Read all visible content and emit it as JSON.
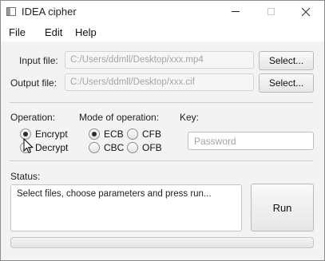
{
  "window": {
    "title": "IDEA cipher",
    "icon": "app-window-icon"
  },
  "menu": {
    "items": [
      "File",
      "Edit",
      "Help"
    ]
  },
  "files": {
    "input_label": "Input file:",
    "input_value": "C:/Users/ddmll/Desktop/xxx.mp4",
    "output_label": "Output file:",
    "output_value": "C:/Users/ddmll/Desktop/xxx.cif",
    "select_label": "Select..."
  },
  "operation": {
    "label": "Operation:",
    "options": [
      "Encrypt",
      "Decrypt"
    ],
    "selected": "Encrypt"
  },
  "mode": {
    "label": "Mode of operation:",
    "options": [
      "ECB",
      "CFB",
      "CBC",
      "OFB"
    ],
    "selected": "ECB"
  },
  "key": {
    "label": "Key:",
    "placeholder": "Password",
    "value": ""
  },
  "status": {
    "label": "Status:",
    "text": "Select files, choose parameters and press run...",
    "progress": 0
  },
  "run_label": "Run"
}
